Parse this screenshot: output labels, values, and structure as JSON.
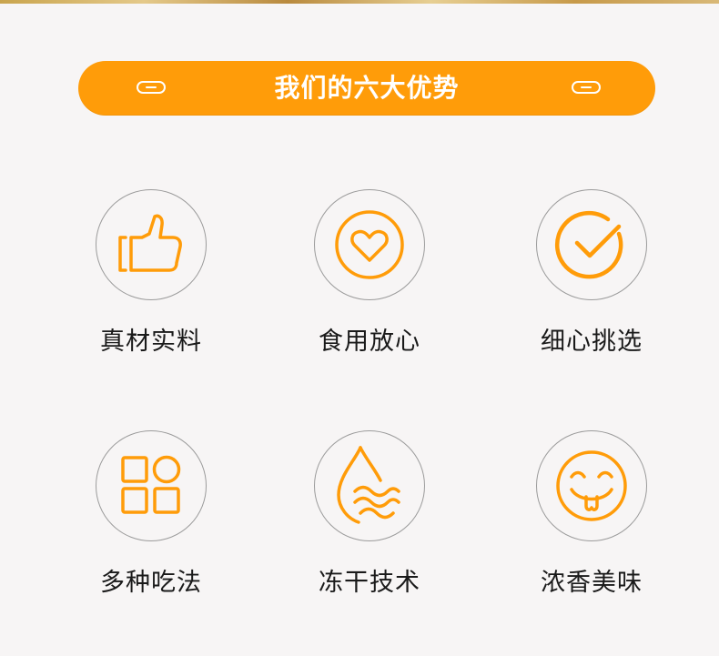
{
  "banner": {
    "title": "我们的六大优势"
  },
  "features": [
    {
      "label": "真材实料",
      "icon": "thumbs-up-icon"
    },
    {
      "label": "食用放心",
      "icon": "heart-icon"
    },
    {
      "label": "细心挑选",
      "icon": "checkmark-icon"
    },
    {
      "label": "多种吃法",
      "icon": "grid-icon"
    },
    {
      "label": "冻干技术",
      "icon": "water-drop-icon"
    },
    {
      "label": "浓香美味",
      "icon": "smiley-face-icon"
    }
  ],
  "colors": {
    "accent": "#ff9c09",
    "background": "#f7f5f5",
    "circle_border": "#9b9b9b",
    "text": "#1a1a1a"
  }
}
